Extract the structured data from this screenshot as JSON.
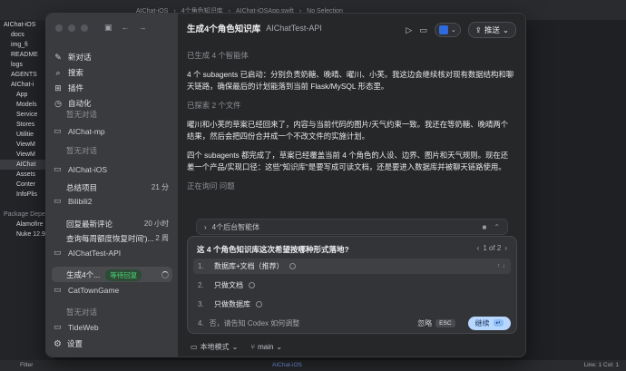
{
  "xcode": {
    "breadcrumb": [
      "AIChat-iOS",
      "4个角色知识库",
      "AIChat-iOSApp.swift",
      "No Selection"
    ],
    "navigator": [
      {
        "label": "AIChat-iOS",
        "dim": false
      },
      {
        "label": "docs",
        "dim": false
      },
      {
        "label": "img_fi",
        "dim": false
      },
      {
        "label": "README",
        "dim": false
      },
      {
        "label": "logs",
        "dim": false
      },
      {
        "label": "AGENTS",
        "dim": false
      },
      {
        "label": "AIChat-i",
        "dim": false
      },
      {
        "label": "App",
        "dim": false
      },
      {
        "label": "Models",
        "dim": false
      },
      {
        "label": "Service",
        "dim": false
      },
      {
        "label": "Stores",
        "dim": false
      },
      {
        "label": "Utilitie",
        "dim": false
      },
      {
        "label": "ViewM",
        "dim": false
      },
      {
        "label": "ViewM",
        "dim": false
      },
      {
        "label": "AIChat",
        "dim": false
      },
      {
        "label": "Assets",
        "dim": false
      },
      {
        "label": "Conter",
        "dim": false
      },
      {
        "label": "InfoPlis",
        "dim": false
      },
      {
        "label": "",
        "dim": false
      },
      {
        "label": "Package Depen",
        "dim": true
      },
      {
        "label": "Alamofire",
        "dim": false
      },
      {
        "label": "Nuke 12.9.",
        "dim": false
      }
    ],
    "filter": "Filter",
    "scheme": "AIChat-iOS",
    "cursor": "Line: 1  Col: 1"
  },
  "sidebar": {
    "nav": [
      {
        "label": "新对话",
        "icon": "new-chat-icon"
      },
      {
        "label": "搜索",
        "icon": "search-icon"
      },
      {
        "label": "插件",
        "icon": "plugin-icon"
      },
      {
        "label": "自动化",
        "icon": "clock-icon"
      }
    ],
    "groups": [
      {
        "name": "",
        "threads": [
          {
            "title": "暂无对话",
            "meta": "",
            "dim": true
          }
        ]
      },
      {
        "name": "AIChat-mp",
        "threads": [
          {
            "title": "暂无对话",
            "meta": "",
            "dim": true
          }
        ]
      },
      {
        "name": "AIChat-iOS",
        "threads": [
          {
            "title": "总结项目",
            "meta": "21 分",
            "dim": false
          }
        ]
      },
      {
        "name": "Bilibili2",
        "threads": [
          {
            "title": "回复最新评论",
            "meta": "20 小时",
            "dim": false
          },
          {
            "title": "查询每周额度恢复时间')...",
            "meta": "2 周",
            "dim": false
          }
        ]
      },
      {
        "name": "AIChatTest-API",
        "threads": [
          {
            "title": "生成4个...",
            "meta": "",
            "dim": false,
            "badge": "等待回复"
          }
        ]
      },
      {
        "name": "CatTownGame",
        "threads": [
          {
            "title": "暂无对话",
            "meta": "",
            "dim": true
          }
        ]
      },
      {
        "name": "TideWeb",
        "threads": []
      }
    ],
    "settings": "设置"
  },
  "header": {
    "title": "生成4个角色知识库",
    "project": "AIChatTest-API",
    "push_label": "推送"
  },
  "messages": [
    {
      "text": "已生成 4 个智能体",
      "kind": "status"
    },
    {
      "text": "4 个 subagents 已启动：分别负责奶糖、晚晴、曜川、小芙。我这边会继续核对现有数据结构和聊天链路，确保最后的计划能落到当前 Flask/MySQL 形态里。",
      "kind": "bright"
    },
    {
      "text": "已探索 2 个文件",
      "kind": "status"
    },
    {
      "text": "曜川和小芙的草案已经回来了，内容与当前代码的图片/天气约束一致。我还在等奶糖、晚晴两个结果，然后会把四份合并成一个不改文件的实施计划。",
      "kind": "bright"
    },
    {
      "text": "四个 subagents 都完成了，草案已经覆盖当前 4 个角色的人设、边界、图片和天气规则。现在还差一个产品/实现口径：这些\"知识库\"是要写成可读文档，还是要进入数据库并被聊天链路使用。",
      "kind": "bright"
    },
    {
      "text": "正在询问 问题",
      "kind": "status"
    }
  ],
  "agents_bar": {
    "label": "4个后台智能体"
  },
  "question": {
    "title": "这 4 个角色知识库这次希望按哪种形式落地?",
    "pager": "1 of 2",
    "options": [
      {
        "num": "1.",
        "label": "数据库+文档（推荐）",
        "active": true
      },
      {
        "num": "2.",
        "label": "只做文档",
        "active": false
      },
      {
        "num": "3.",
        "label": "只做数据库",
        "active": false
      }
    ],
    "input_num": "4.",
    "placeholder": "否，请告知 Codex 如何调整",
    "ignore_label": "忽略",
    "esc_key": "ESC",
    "continue_label": "继续",
    "continue_key": "↵"
  },
  "footer": {
    "mode": "本地模式",
    "branch": "main"
  }
}
